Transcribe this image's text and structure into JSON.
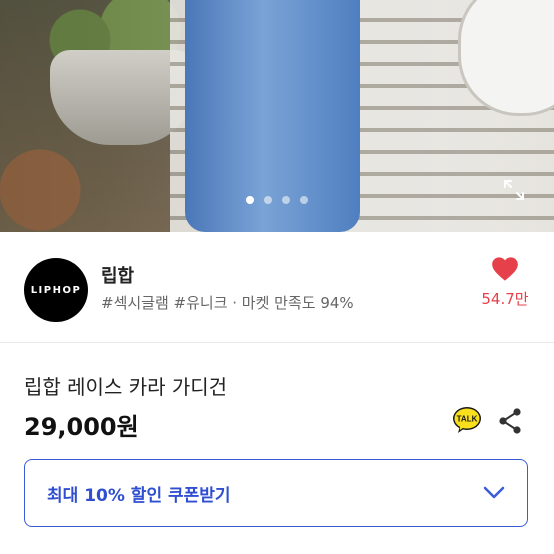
{
  "hero": {
    "slide_count": 4,
    "active_slide": 1
  },
  "shop": {
    "logo_text": "LIPHOP",
    "name": "립합",
    "tags": "#섹시글램 #유니크 · 마켓 만족도 94%",
    "like_count": "54.7만"
  },
  "product": {
    "title": "립합 레이스 카라 가디건",
    "price": "29,000원"
  },
  "actions": {
    "talk_label": "TALK"
  },
  "coupon": {
    "label": "최대 10% 할인 쿠폰받기"
  },
  "colors": {
    "accent": "#3b5bd9",
    "heart": "#e6414a"
  }
}
